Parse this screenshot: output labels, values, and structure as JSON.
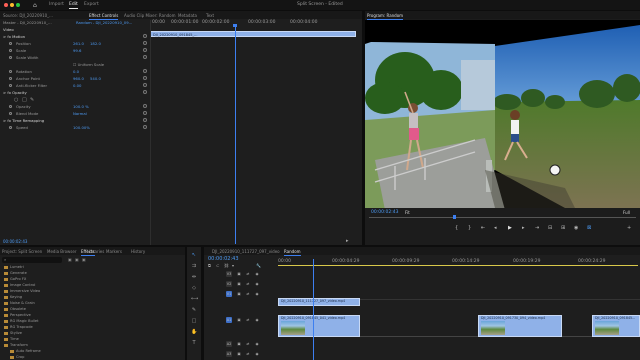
{
  "window": {
    "menu": [
      "Import",
      "Edit",
      "Export"
    ],
    "active_menu": "Edit",
    "title": "Split Screen - Edited"
  },
  "source_panel": {
    "tabs": [
      "Source: DJI_20220910_...",
      "Effect Controls",
      "Audio Clip Mixer: Random",
      "Metadata",
      "Text"
    ],
    "active_tab": "Effect Controls",
    "master": "Master - DJI_20220910_...",
    "sequence": "Random - DJI_20220910_09...",
    "ruler": [
      "00:00",
      "00:00:01:00",
      "00:00:02:00",
      "00:00:03:00",
      "00:00:04:00"
    ],
    "clip_label": "DJI_20220910_091845_...",
    "rows": [
      {
        "label": "Video",
        "kind": "head"
      },
      {
        "label": "fx  Motion",
        "kind": "section"
      },
      {
        "label": "Position",
        "v1": "261.0",
        "v2": "182.0"
      },
      {
        "label": "Scale",
        "v1": "99.6"
      },
      {
        "label": "Scale Width",
        "v1": ""
      },
      {
        "label": "",
        "v1": "",
        "check": "Uniform Scale"
      },
      {
        "label": "Rotation",
        "v1": "0.0"
      },
      {
        "label": "Anchor Point",
        "v1": "960.0",
        "v2": "540.0"
      },
      {
        "label": "Anti-flicker Filter",
        "v1": "0.00"
      },
      {
        "label": "fx  Opacity",
        "kind": "section"
      },
      {
        "label": "",
        "kind": "masks"
      },
      {
        "label": "Opacity",
        "v1": "100.0 %"
      },
      {
        "label": "Blend Mode",
        "v1": "Normal"
      },
      {
        "label": "fx  Time Remapping",
        "kind": "section"
      },
      {
        "label": "Speed",
        "v1": "100.00%"
      }
    ],
    "timecode": "00:00:02:43"
  },
  "program_monitor": {
    "title": "Program: Random",
    "timecode": "00:00:02:43",
    "zoom": "Fit",
    "quality": "Full"
  },
  "effects_panel": {
    "tabs": [
      "Project: Split Screen",
      "Media Browser",
      "Libraries",
      "Info",
      "Effects",
      "Markers",
      "History"
    ],
    "active_tab": "Effects",
    "items": [
      "Lumetri",
      "Generate",
      "GoPro FX",
      "Image Control",
      "Immersive Video",
      "Keying",
      "Noise & Grain",
      "Obsolete",
      "Perspective",
      "RG Magic Bullet",
      "RG Trapcode",
      "Stylize",
      "Time",
      "Transform",
      "Auto Reframe",
      "Crop"
    ]
  },
  "timeline": {
    "tabs": [
      "DJI_20220910_111727_097_video",
      "Random"
    ],
    "active_tab": "Random",
    "timecode": "00:00:02:43",
    "ruler": [
      "00:00",
      "00:00:04:29",
      "00:00:09:29",
      "00:00:14:29",
      "00:00:19:29",
      "00:00:24:29"
    ],
    "tracks": [
      "V3",
      "V2",
      "V1",
      "A1",
      "A2",
      "A3"
    ],
    "clips": [
      {
        "label": "DJI_20220910_111727_097_video.mp4",
        "track": "V2"
      },
      {
        "label": "DJI_20220910_091845_041_video.mp4",
        "track": "V1"
      },
      {
        "label": "DJI_20220910_091730_094_video.mp4",
        "track": "V1"
      },
      {
        "label": "DJI_20220910_091845...",
        "track": "V1"
      }
    ]
  },
  "colors": {
    "accent": "#4d9bf4",
    "clip": "#8fb1e8",
    "panel": "#1e1e1e",
    "ruler_marker": "#d9c84a"
  }
}
